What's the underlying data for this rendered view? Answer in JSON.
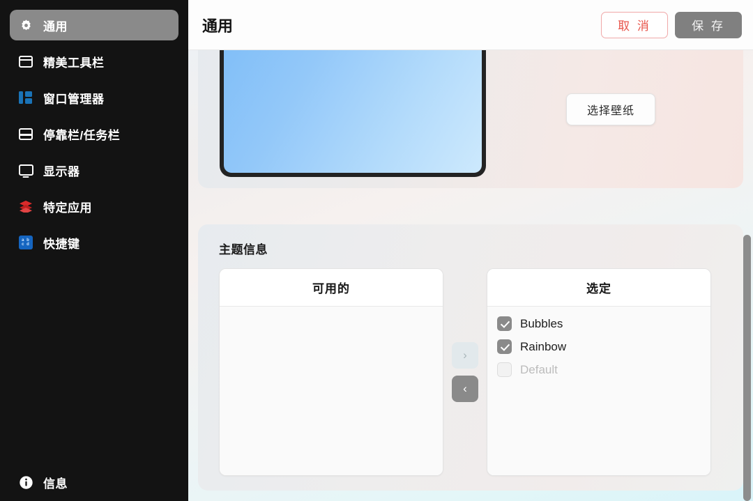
{
  "sidebar": {
    "items": [
      {
        "label": "通用",
        "icon": "gear-icon",
        "active": true
      },
      {
        "label": "精美工具栏",
        "icon": "window-titlebar-icon",
        "active": false
      },
      {
        "label": "窗口管理器",
        "icon": "window-manager-icon",
        "active": false
      },
      {
        "label": "停靠栏/任务栏",
        "icon": "dock-taskbar-icon",
        "active": false
      },
      {
        "label": "显示器",
        "icon": "monitor-icon",
        "active": false
      },
      {
        "label": "特定应用",
        "icon": "layers-icon",
        "active": false
      },
      {
        "label": "快捷键",
        "icon": "keyboard-abcd-icon",
        "active": false
      }
    ],
    "info": {
      "label": "信息",
      "icon": "info-circle-icon"
    },
    "active_bg": "#8a8a8a",
    "bg": "#131313"
  },
  "header": {
    "title": "通用",
    "cancel_label": "取 消",
    "save_label": "保 存",
    "cancel_color": "#e8544a",
    "save_bg": "#808080"
  },
  "wallpaper": {
    "choose_label": "选择壁纸",
    "screen_gradient_from": "#7cbcf8",
    "screen_gradient_to": "#cde9fd"
  },
  "theme": {
    "section_title": "主题信息",
    "available": {
      "header": "可用的",
      "rows": []
    },
    "selected": {
      "header": "选定",
      "rows": [
        {
          "label": "Bubbles",
          "checked": true,
          "disabled": false
        },
        {
          "label": "Rainbow",
          "checked": true,
          "disabled": false
        },
        {
          "label": "Default",
          "checked": false,
          "disabled": true
        }
      ]
    },
    "move_right_label": "›",
    "move_left_label": "‹"
  }
}
